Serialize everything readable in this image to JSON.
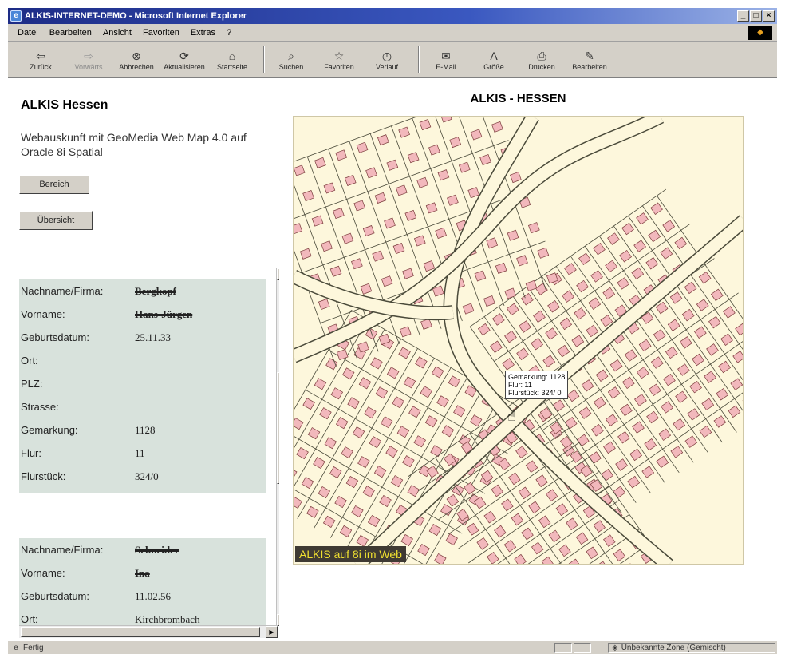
{
  "window": {
    "title": "ALKIS-INTERNET-DEMO - Microsoft Internet Explorer",
    "min": "_",
    "max": "□",
    "close": "×"
  },
  "menu": [
    "Datei",
    "Bearbeiten",
    "Ansicht",
    "Favoriten",
    "Extras",
    "?"
  ],
  "toolbar": [
    {
      "label": "Zurück",
      "icon": "back-arrow-icon",
      "glyph": "⇦"
    },
    {
      "label": "Vorwärts",
      "icon": "forward-arrow-icon",
      "glyph": "⇨"
    },
    {
      "label": "Abbrechen",
      "icon": "stop-icon",
      "glyph": "⊗"
    },
    {
      "label": "Aktualisieren",
      "icon": "refresh-icon",
      "glyph": "⟳"
    },
    {
      "label": "Startseite",
      "icon": "home-icon",
      "glyph": "⌂"
    },
    {
      "label": "Suchen",
      "icon": "search-icon",
      "glyph": "⌕"
    },
    {
      "label": "Favoriten",
      "icon": "favorites-icon",
      "glyph": "☆"
    },
    {
      "label": "Verlauf",
      "icon": "history-icon",
      "glyph": "◷"
    },
    {
      "label": "E-Mail",
      "icon": "mail-icon",
      "glyph": "✉"
    },
    {
      "label": "Größe",
      "icon": "font-size-icon",
      "glyph": "A"
    },
    {
      "label": "Drucken",
      "icon": "print-icon",
      "glyph": "⎙"
    },
    {
      "label": "Bearbeiten",
      "icon": "edit-icon",
      "glyph": "✎"
    }
  ],
  "left": {
    "title": "ALKIS Hessen",
    "description": "Webauskunft mit GeoMedia Web Map 4.0 auf Oracle 8i Spatial",
    "btn_bereich": "Bereich",
    "btn_uebersicht": "Übersicht"
  },
  "records": [
    {
      "fields": [
        {
          "k": "Nachname/Firma:",
          "v": "Bergkopf",
          "struck": true
        },
        {
          "k": "Vorname:",
          "v": "Hans-Jürgen",
          "struck": true
        },
        {
          "k": "Geburtsdatum:",
          "v": "25.11.33"
        },
        {
          "k": "Ort:",
          "v": ""
        },
        {
          "k": "PLZ:",
          "v": ""
        },
        {
          "k": "Strasse:",
          "v": ""
        },
        {
          "k": "Gemarkung:",
          "v": "1128"
        },
        {
          "k": "Flur:",
          "v": "11"
        },
        {
          "k": "Flurstück:",
          "v": "324/0"
        }
      ]
    },
    {
      "fields": [
        {
          "k": "Nachname/Firma:",
          "v": "Schneider",
          "struck": true
        },
        {
          "k": "Vorname:",
          "v": "Ina",
          "struck": true
        },
        {
          "k": "Geburtsdatum:",
          "v": "11.02.56"
        },
        {
          "k": "Ort:",
          "v": "Kirchbrombach"
        }
      ]
    }
  ],
  "map": {
    "title": "ALKIS - HESSEN",
    "tooltip": [
      "Gemarkung: 1128",
      "Flur: 11",
      "Flurstück: 324/ 0"
    ],
    "caption": "ALKIS auf 8i im Web",
    "colors": {
      "background": "#fdf7dc",
      "building": "#f2b8bc",
      "line": "#4a4a3a"
    }
  },
  "status": {
    "left": "Fertig",
    "zone": "Unbekannte Zone (Gemischt)"
  }
}
